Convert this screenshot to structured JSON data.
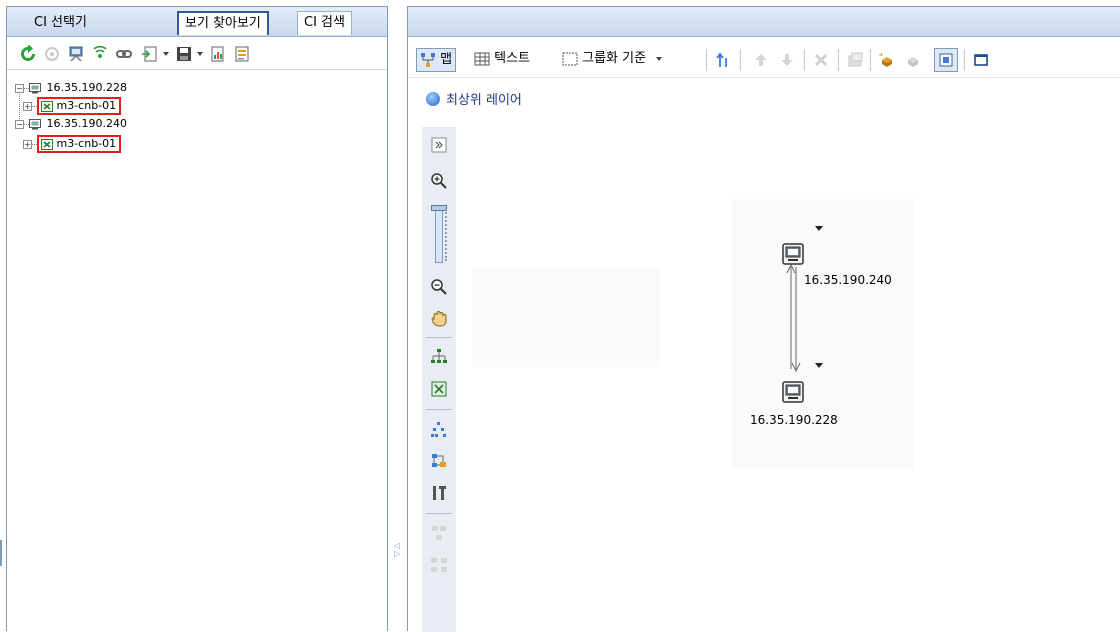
{
  "left_panel": {
    "tabs": [
      {
        "label": "CI 선택기",
        "active": false
      },
      {
        "label": "보기 찾아보기",
        "active": true
      },
      {
        "label": "CI 검색",
        "active": false
      }
    ],
    "toolbar_icons": [
      "refresh-icon",
      "disabled-action-icon",
      "computer-icon",
      "wireless-icon",
      "link-icon",
      "new-item-icon",
      "save-icon",
      "report-icon",
      "properties-icon"
    ],
    "tree": [
      {
        "label": "16.35.190.228",
        "level": 0,
        "expanded": true,
        "icon": "host-icon"
      },
      {
        "label": "m3-cnb-01",
        "level": 1,
        "expanded": false,
        "icon": "switch-icon",
        "highlighted": true
      },
      {
        "label": "16.35.190.240",
        "level": 0,
        "expanded": true,
        "icon": "host-icon"
      },
      {
        "label": "m3-cnb-01",
        "level": 1,
        "expanded": false,
        "icon": "switch-icon",
        "highlighted": true
      }
    ]
  },
  "right_panel": {
    "toolbar": {
      "map_label": "맵",
      "text_label": "텍스트",
      "group_label": "그룹화 기준"
    },
    "layer_link": "최상위 레이어",
    "map_tools": [
      "expand-icon",
      "zoom-in-icon",
      "zoom-slider",
      "zoom-out-icon",
      "pan-hand-icon",
      "hierarchy-layout-icon",
      "fit-to-window-icon",
      "tree-layout-icon",
      "organic-layout-icon",
      "tools-icon",
      "group-disabled-icon",
      "ungroup-disabled-icon"
    ],
    "nodes": [
      {
        "label": "16.35.190.240",
        "icon": "computer-node-icon"
      },
      {
        "label": "16.35.190.228",
        "icon": "computer-node-icon"
      }
    ]
  },
  "colors": {
    "tab_bar": "#c9d8ee",
    "border": "#7f9db9",
    "highlight": "#e02020",
    "link_text": "#1a3a8a"
  }
}
